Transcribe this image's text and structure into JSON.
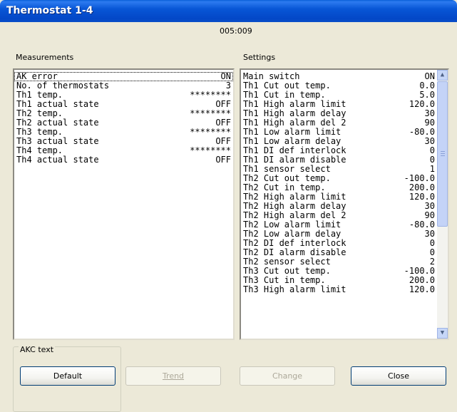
{
  "window": {
    "title": "Thermostat 1-4",
    "address": "005:009"
  },
  "measurements": {
    "label": "Measurements",
    "rows": [
      {
        "label": "AK error",
        "value": "ON"
      },
      {
        "label": "No. of thermostats",
        "value": "3"
      },
      {
        "label": "Th1 temp.",
        "value": "********"
      },
      {
        "label": "Th1 actual state",
        "value": "OFF"
      },
      {
        "label": "Th2 temp.",
        "value": "********"
      },
      {
        "label": "Th2 actual state",
        "value": "OFF"
      },
      {
        "label": "Th3 temp.",
        "value": "********"
      },
      {
        "label": "Th3 actual state",
        "value": "OFF"
      },
      {
        "label": "Th4 temp.",
        "value": "********"
      },
      {
        "label": "Th4 actual state",
        "value": "OFF"
      }
    ]
  },
  "settings": {
    "label": "Settings",
    "rows": [
      {
        "label": "Main switch",
        "value": "ON"
      },
      {
        "label": "Th1 Cut out temp.",
        "value": "0.0"
      },
      {
        "label": "Th1 Cut in temp.",
        "value": "5.0"
      },
      {
        "label": "Th1 High alarm limit",
        "value": "120.0"
      },
      {
        "label": "Th1 High alarm delay",
        "value": "30"
      },
      {
        "label": "Th1 High alarm del 2",
        "value": "90"
      },
      {
        "label": "Th1 Low alarm limit",
        "value": "-80.0"
      },
      {
        "label": "Th1 Low alarm delay",
        "value": "30"
      },
      {
        "label": "Th1 DI def interlock",
        "value": "0"
      },
      {
        "label": "Th1 DI alarm disable",
        "value": "0"
      },
      {
        "label": "Th1 sensor select",
        "value": "1"
      },
      {
        "label": "Th2 Cut out temp.",
        "value": "-100.0"
      },
      {
        "label": "Th2 Cut in temp.",
        "value": "200.0"
      },
      {
        "label": "Th2 High alarm limit",
        "value": "120.0"
      },
      {
        "label": "Th2 High alarm delay",
        "value": "30"
      },
      {
        "label": "Th2 High alarm del 2",
        "value": "90"
      },
      {
        "label": "Th2 Low alarm limit",
        "value": "-80.0"
      },
      {
        "label": "Th2 Low alarm delay",
        "value": "30"
      },
      {
        "label": "Th2 DI def interlock",
        "value": "0"
      },
      {
        "label": "Th2 DI alarm disable",
        "value": "0"
      },
      {
        "label": "Th2 sensor select",
        "value": "2"
      },
      {
        "label": "Th3 Cut out temp.",
        "value": "-100.0"
      },
      {
        "label": "Th3 Cut in temp.",
        "value": "200.0"
      },
      {
        "label": "Th3 High alarm limit",
        "value": "120.0"
      }
    ]
  },
  "akc_group": {
    "label": "AKC text"
  },
  "buttons": {
    "default": "Default",
    "trend": "Trend",
    "change": "Change",
    "close": "Close"
  }
}
